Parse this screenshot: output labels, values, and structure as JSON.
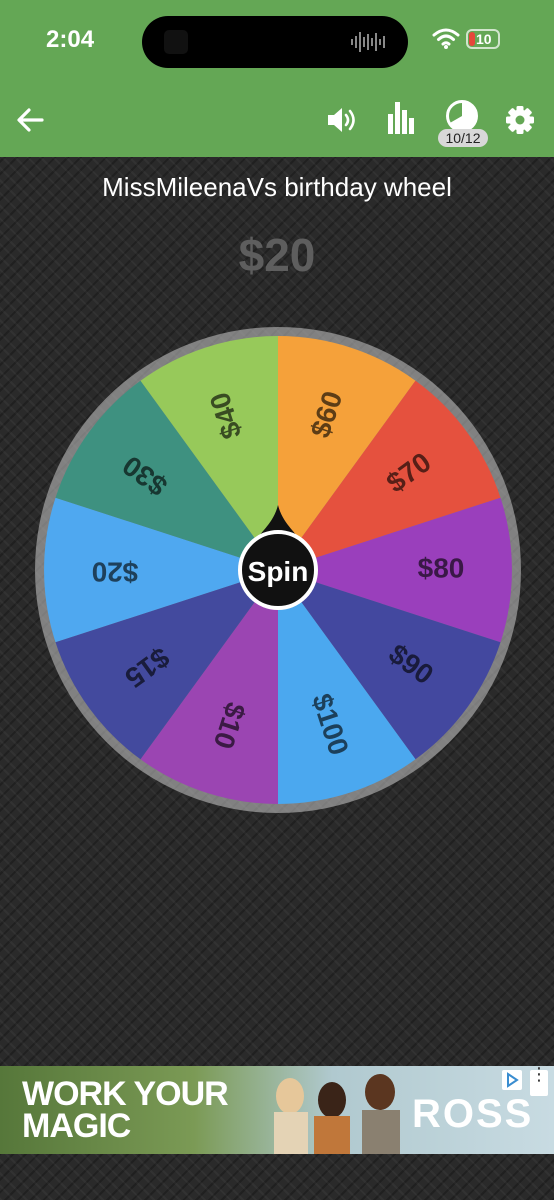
{
  "status_bar": {
    "time": "2:04",
    "battery": "10"
  },
  "toolbar": {
    "back_icon": "arrow-left-icon",
    "sound_icon": "volume-icon",
    "stats_icon": "bar-chart-icon",
    "progress_icon": "pie-progress-icon",
    "counter": "10/12",
    "settings_icon": "gear-icon"
  },
  "wheel": {
    "title": "MissMileenaVs birthday wheel",
    "result": "$20",
    "spin_label": "Spin",
    "segments": [
      {
        "label": "$20",
        "color": "#4fa8f0"
      },
      {
        "label": "$30",
        "color": "#3e9180"
      },
      {
        "label": "$40",
        "color": "#97c95a"
      },
      {
        "label": "$60",
        "color": "#f5a13a"
      },
      {
        "label": "$70",
        "color": "#e5513e"
      },
      {
        "label": "$80",
        "color": "#9a3fbc"
      },
      {
        "label": "$90",
        "color": "#43489f"
      },
      {
        "label": "$100",
        "color": "#4ba8ef"
      },
      {
        "label": "$10",
        "color": "#9b45b2"
      },
      {
        "label": "$15",
        "color": "#434a9e"
      }
    ],
    "colors": {
      "background": "#2a2a2a",
      "topbar": "#64a755"
    }
  },
  "ad": {
    "headline_line1": "WORK YOUR",
    "headline_line2": "MAGIC",
    "brand": "ROSS",
    "menu_icon": "more-vertical-icon",
    "adchoices_icon": "ad-choices-icon"
  }
}
